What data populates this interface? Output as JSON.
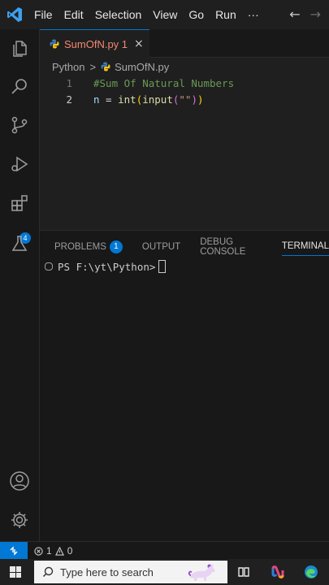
{
  "titlebar": {
    "menu": [
      "File",
      "Edit",
      "Selection",
      "View",
      "Go",
      "Run",
      "···"
    ],
    "back_label": "←",
    "forward_label": "→"
  },
  "activity_bar": {
    "icons": [
      "explorer-icon",
      "search-icon",
      "source-control-icon",
      "run-debug-icon",
      "extensions-icon",
      "testing-icon",
      "accounts-icon",
      "settings-gear-icon"
    ],
    "extensions_badge": "4"
  },
  "editor_tab": {
    "label": "SumOfN.py 1",
    "close": "×"
  },
  "breadcrumb": {
    "items": [
      "Python",
      "SumOfN.py"
    ],
    "separator": ">"
  },
  "editor": {
    "lines": [
      {
        "number": "1",
        "text": "#Sum Of Natural Numbers"
      },
      {
        "number": "2",
        "text": "n = int(input(\"\"))"
      }
    ]
  },
  "panel": {
    "tabs": [
      "PROBLEMS",
      "OUTPUT",
      "DEBUG CONSOLE",
      "TERMINAL"
    ],
    "problems_count": "1",
    "active_tab": "TERMINAL",
    "terminal_prompt": "PS F:\\yt\\Python>"
  },
  "status_bar": {
    "remote_icon": "remote-icon",
    "errors": "1",
    "warnings": "0"
  },
  "taskbar": {
    "search_placeholder": "Type here to search"
  },
  "colors": {
    "accent": "#0078d4",
    "tab_error_text": "#f48771",
    "comment": "#6a9955",
    "function": "#dcdcaa"
  }
}
